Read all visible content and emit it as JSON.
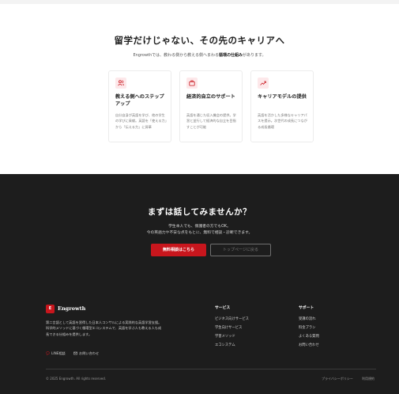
{
  "career": {
    "title": "留学だけじゃない、その先のキャリアへ",
    "subtitle_pre": "Engrowthでは、教わる側から教える側へまわる",
    "subtitle_bold": "循環の仕組み",
    "subtitle_post": "があります。",
    "cards": [
      {
        "icon": "users-icon",
        "title": "教える側へのステップアップ",
        "body": "自分自身が英語を学び、他の学生の学びに貢献。英語を「使える力」から「伝える力」に昇華"
      },
      {
        "icon": "briefcase-icon",
        "title": "経済的自立のサポート",
        "body": "英語を通じた収入機会の提供。学習と並行して経済的な自立を目指すことが可能"
      },
      {
        "icon": "trend-chart-icon",
        "title": "キャリアモデルの提供",
        "body": "英語を活かした多様なキャリアパスを提示。次世代の成長につながる成長循環"
      }
    ]
  },
  "cta": {
    "title": "まずは話してみませんか？",
    "line1": "学生本人でも、保護者の方でもOK。",
    "line2": "今の英語力や不安な点をもとに、無料で相談・診断できます。",
    "primary_button": "無料相談はこちら",
    "secondary_button": "トップページに戻る"
  },
  "footer": {
    "brand_logo": "E",
    "brand_name": "Engrowth",
    "description": "第二言語として英語を習得した日本人コンサルによる実践的な英語学習支援。科学的メソッドに基づく循環型エコシステムで、英語を学ぶ人も教える人も成長できる仕組みを提供します。",
    "social": [
      "LINE相談",
      "お問い合わせ"
    ],
    "col1": {
      "heading": "サービス",
      "links": [
        "ビジネス向けサービス",
        "学生向けサービス",
        "学習メソッド",
        "エコシステム"
      ]
    },
    "col2": {
      "heading": "サポート",
      "links": [
        "受講の流れ",
        "料金プラン",
        "よくある質問",
        "お問い合わせ"
      ]
    },
    "copyright": "© 2025 Engrowth. All rights reserved.",
    "legal": [
      "プライバシーポリシー",
      "利用規約"
    ]
  },
  "colors": {
    "accent": "#c8161d",
    "dark_bg": "#1d1d1d",
    "card_icon_bg": "#fde8ea"
  }
}
